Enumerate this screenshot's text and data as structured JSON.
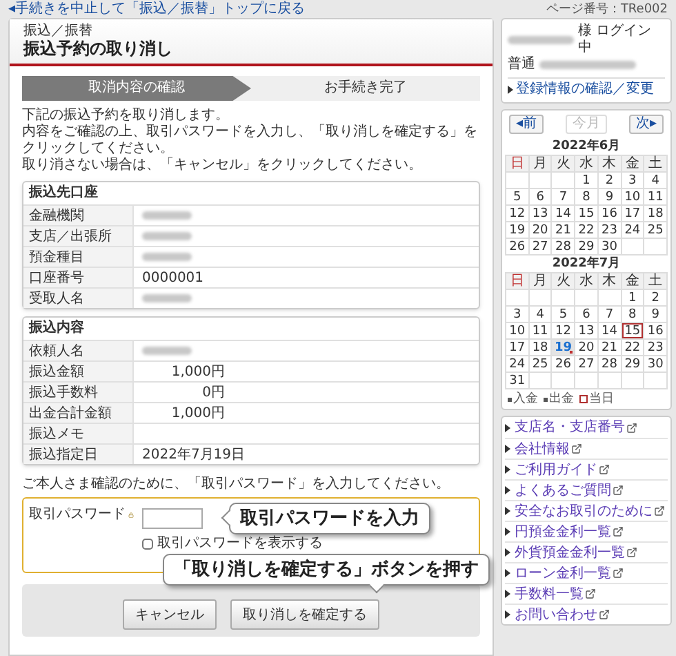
{
  "top_link": "◂手続きを中止して「振込／振替」トップに戻る",
  "page_number": "ページ番号：TRe002",
  "header": {
    "breadcrumb": "振込／振替",
    "title": "振込予約の取り消し"
  },
  "steps": [
    {
      "label": "取消内容の確認",
      "selected": true
    },
    {
      "label": "お手続き完了",
      "selected": false
    }
  ],
  "intro": [
    "下記の振込予約を取り消します。",
    "内容をご確認の上、取引パスワードを入力し、「取り消しを確定する」をクリックしてください。",
    "取り消さない場合は、「キャンセル」をクリックしてください。"
  ],
  "sections": [
    {
      "title": "振込先口座",
      "rows": [
        {
          "label": "金融機関",
          "redacted": true
        },
        {
          "label": "支店／出張所",
          "redacted": true
        },
        {
          "label": "預金種目",
          "redacted": true
        },
        {
          "label": "口座番号",
          "value": "0000001"
        },
        {
          "label": "受取人名",
          "redacted": true
        }
      ]
    },
    {
      "title": "振込内容",
      "rows": [
        {
          "label": "依頼人名",
          "redacted": true
        },
        {
          "label": "振込金額",
          "value": "1,000円",
          "kind": "amount"
        },
        {
          "label": "振込手数料",
          "value": "0円",
          "kind": "amount"
        },
        {
          "label": "出金合計金額",
          "value": "1,000円",
          "kind": "amount"
        },
        {
          "label": "振込メモ"
        },
        {
          "label": "振込指定日",
          "value": "2022年7月19日"
        }
      ]
    }
  ],
  "password_note": "ご本人さま確認のために、「取引パスワード」を入力してください。",
  "password": {
    "label": "取引パスワード",
    "show_checkbox": {
      "label": "取引パスワードを表示する",
      "checked": false
    }
  },
  "buttons": [
    {
      "label": "キャンセル"
    },
    {
      "label": "取り消しを確定する"
    }
  ],
  "callouts": [
    {
      "text": "取引パスワードを入力",
      "kind": "left"
    },
    {
      "text": "「取り消しを確定する」ボタンを押す",
      "kind": "down"
    }
  ],
  "user": {
    "honorific": "様 ログイン中",
    "account_type": "普通",
    "link": "登録情報の確認／変更"
  },
  "calendar": {
    "prev": "◂前",
    "current": "今月",
    "next": "次▸",
    "current_disabled": true,
    "months": [
      {
        "title": "2022年6月",
        "weekdays": [
          "日",
          "月",
          "火",
          "水",
          "木",
          "金",
          "土"
        ],
        "weeks": [
          {
            "kind": "lead",
            "days": [
              "1",
              "2",
              "3",
              "4"
            ]
          },
          {
            "days": [
              "5",
              "6",
              "7",
              "8",
              "9",
              "10",
              "11"
            ]
          },
          {
            "days": [
              "12",
              "13",
              "14",
              "15",
              "16",
              "17",
              "18"
            ]
          },
          {
            "days": [
              "19",
              "20",
              "21",
              "22",
              "23",
              "24",
              "25"
            ]
          },
          {
            "days": [
              "26",
              "27",
              "28",
              "29",
              "30"
            ]
          }
        ]
      },
      {
        "title": "2022年7月",
        "weekdays": [
          "日",
          "月",
          "火",
          "水",
          "木",
          "金",
          "土"
        ],
        "weeks": [
          {
            "kind": "lead",
            "days": [
              "1",
              "2"
            ]
          },
          {
            "days": [
              "3",
              "4",
              "5",
              "6",
              "7",
              "8",
              "9"
            ]
          },
          {
            "days": [
              "10",
              "11",
              "12",
              "13",
              "14",
              {
                "text": "15",
                "kind": "today"
              },
              "16"
            ]
          },
          {
            "days": [
              "17",
              "18",
              {
                "text": "19",
                "kind": "scheduled"
              },
              "20",
              "21",
              "22",
              "23"
            ]
          },
          {
            "days": [
              "24",
              "25",
              "26",
              "27",
              "28",
              "29",
              "30"
            ]
          },
          {
            "days": [
              "31"
            ]
          }
        ]
      }
    ],
    "legend": [
      {
        "text": "入金",
        "kind": "dot"
      },
      {
        "text": "出金",
        "kind": "dot"
      },
      {
        "text": "当日",
        "kind": "box"
      }
    ]
  },
  "nav_links": [
    "支店名・支店番号",
    "会社情報",
    "ご利用ガイド",
    "よくあるご質問",
    "安全なお取引のために",
    "円預金金利一覧",
    "外貨預金金利一覧",
    "ローン金利一覧",
    "手数料一覧",
    "お問い合わせ"
  ]
}
